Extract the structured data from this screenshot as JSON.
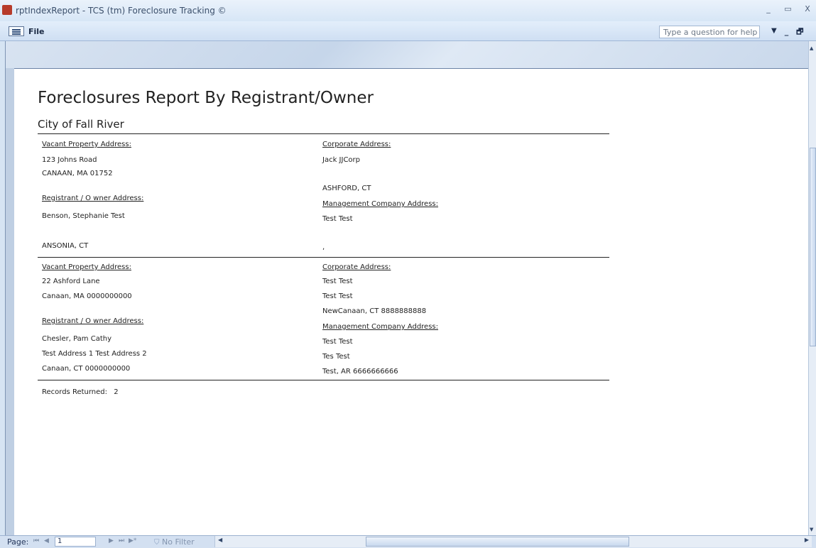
{
  "window": {
    "title": "rptIndexReport - TCS (tm) Foreclosure Tracking ©",
    "controls": [
      "_",
      "▭",
      "X"
    ]
  },
  "menubar": {
    "file": "File",
    "help_placeholder": "Type a question for help",
    "help_dropdown": "▼",
    "doc_controls": [
      "_",
      "🗗",
      "×"
    ]
  },
  "report": {
    "title": "Foreclosures Report By Registrant/Owner",
    "subtitle": "City of Fall River",
    "records": [
      {
        "vacant_label": "Vacant Property Address:",
        "vacant_line1": "123 Johns Road",
        "vacant_line2": "CANAAN, MA 01752",
        "registrant_label": "Registrant / O wner Address:",
        "registrant_line1": "Benson, Stephanie Test",
        "registrant_line2": "",
        "registrant_line3": "ANSONIA, CT",
        "corporate_label": "Corporate Address:",
        "corporate_line1": "Jack JJCorp",
        "corporate_line2": "",
        "corporate_line3": "ASHFORD, CT",
        "management_label": "Management Company Address:",
        "management_line1": "Test Test",
        "management_line2": "",
        "management_line3": ","
      },
      {
        "vacant_label": "Vacant Property Address:",
        "vacant_line1": "22 Ashford Lane",
        "vacant_line2": "Canaan, MA 0000000000",
        "registrant_label": "Registrant / O wner Address:",
        "registrant_line1": "Chesler, Pam Cathy",
        "registrant_line2": "Test Address 1 Test Address 2",
        "registrant_line3": "Canaan, CT 0000000000",
        "corporate_label": "Corporate Address:",
        "corporate_line1": "Test Test",
        "corporate_line2": "Test Test",
        "corporate_line3": "NewCanaan, CT 8888888888",
        "management_label": "Management Company Address:",
        "management_line1": "Test Test",
        "management_line2": "Tes Test",
        "management_line3": "Test, AR 6666666666"
      }
    ],
    "records_returned_label": "Records Returned:",
    "records_returned_value": "2"
  },
  "statusbar": {
    "page_label": "Page:",
    "nav_first": "⏮",
    "nav_prev": "◀",
    "page_number": "1",
    "nav_next": "▶",
    "nav_last": "⏭",
    "nav_new": "▶*",
    "no_filter": "No Filter"
  },
  "colors": {
    "chrome": "#d6e4f3",
    "page": "#ffffff",
    "text": "#222222"
  }
}
